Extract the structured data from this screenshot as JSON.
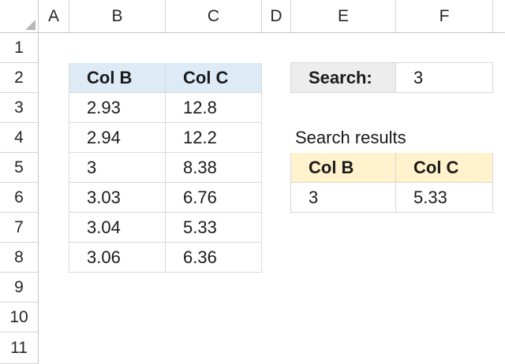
{
  "sheet": {
    "columns": [
      "A",
      "B",
      "C",
      "D",
      "E",
      "F"
    ],
    "rows": [
      "1",
      "2",
      "3",
      "4",
      "5",
      "6",
      "7",
      "8",
      "9",
      "10",
      "11"
    ]
  },
  "data_table": {
    "headers": [
      "Col B",
      "Col C"
    ],
    "rows": [
      [
        "2.93",
        "12.8"
      ],
      [
        "2.94",
        "12.2"
      ],
      [
        "3",
        "8.38"
      ],
      [
        "3.03",
        "6.76"
      ],
      [
        "3.04",
        "5.33"
      ],
      [
        "3.06",
        "6.36"
      ]
    ]
  },
  "search": {
    "label": "Search:",
    "value": "3"
  },
  "results": {
    "title": "Search results",
    "headers": [
      "Col B",
      "Col C"
    ],
    "rows": [
      [
        "3",
        "5.33"
      ]
    ]
  },
  "colors": {
    "data_header_fill": "#ddebf7",
    "results_header_fill": "#fff2cc",
    "search_label_fill": "#ededed"
  }
}
